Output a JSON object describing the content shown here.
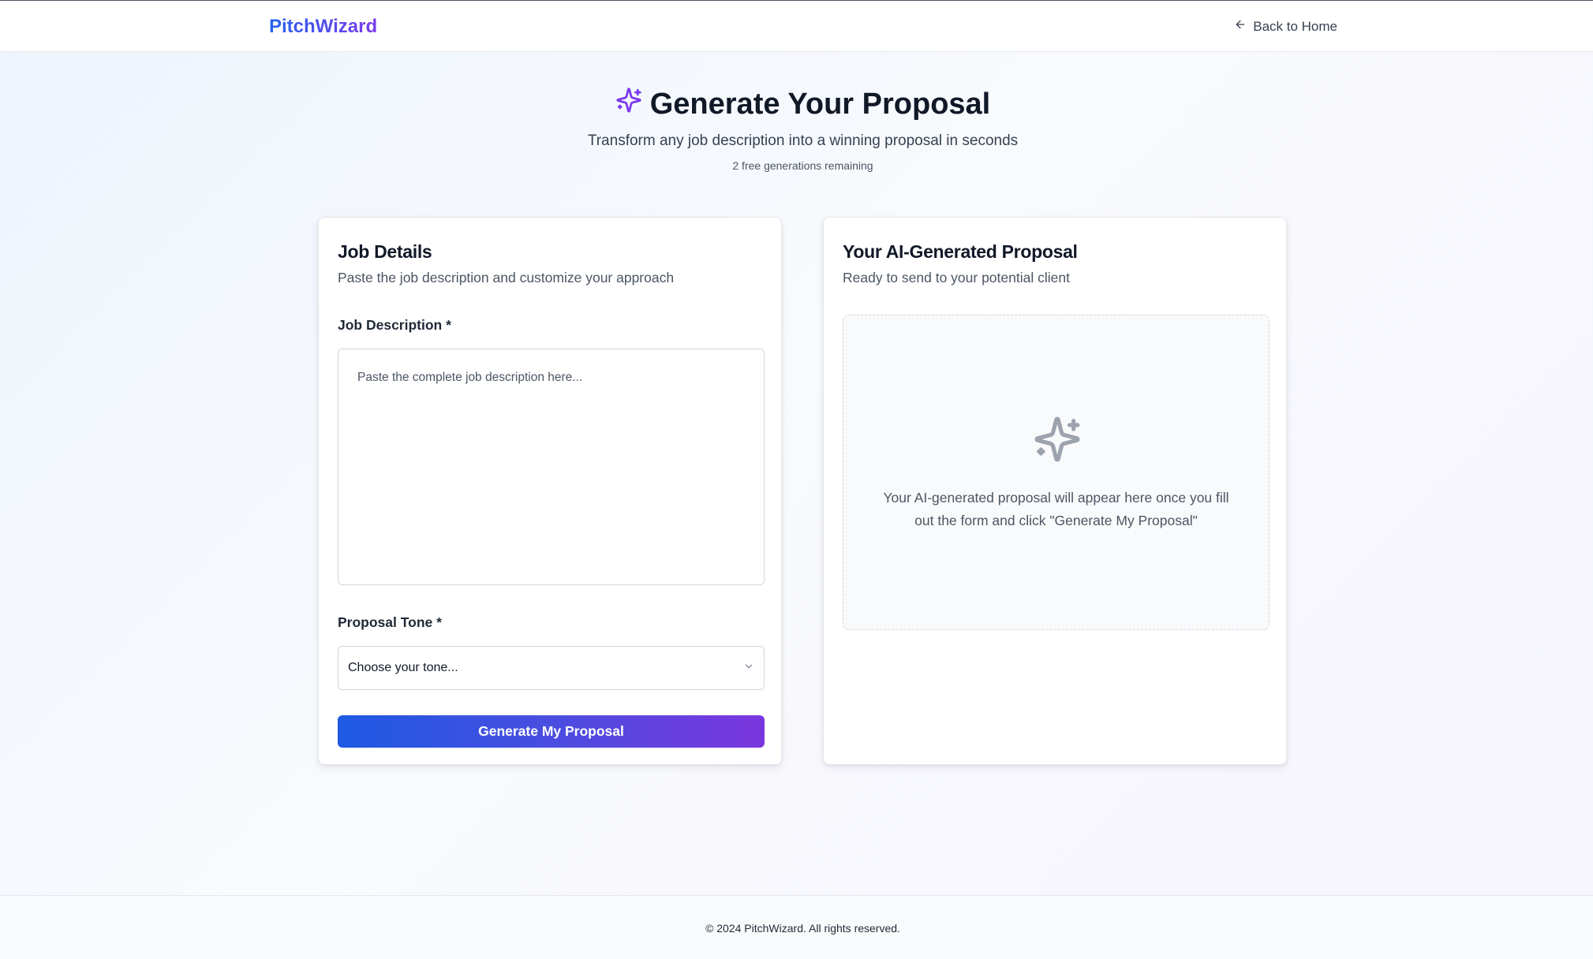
{
  "header": {
    "brand": "PitchWizard",
    "back_link": "Back to Home"
  },
  "hero": {
    "title": "Generate Your Proposal",
    "subtitle": "Transform any job description into a winning proposal in seconds",
    "remaining": "2 free generations remaining",
    "icon": "sparkles-icon"
  },
  "job_details": {
    "title": "Job Details",
    "description": "Paste the job description and customize your approach",
    "job_description_label": "Job Description *",
    "job_description_placeholder": "Paste the complete job description here...",
    "job_description_value": "",
    "tone_label": "Proposal Tone *",
    "tone_selected": "Choose your tone...",
    "generate_button": "Generate My Proposal"
  },
  "proposal": {
    "title": "Your AI-Generated Proposal",
    "description": "Ready to send to your potential client",
    "empty_message": "Your AI-generated proposal will appear here once you fill out the form and click \"Generate My Proposal\""
  },
  "footer": {
    "copyright": "© 2024 PitchWizard. All rights reserved."
  },
  "colors": {
    "brand_gradient_start": "#2563eb",
    "brand_gradient_end": "#7c3aed",
    "accent_purple": "#7c3aed",
    "muted_icon": "#9ca3af"
  }
}
